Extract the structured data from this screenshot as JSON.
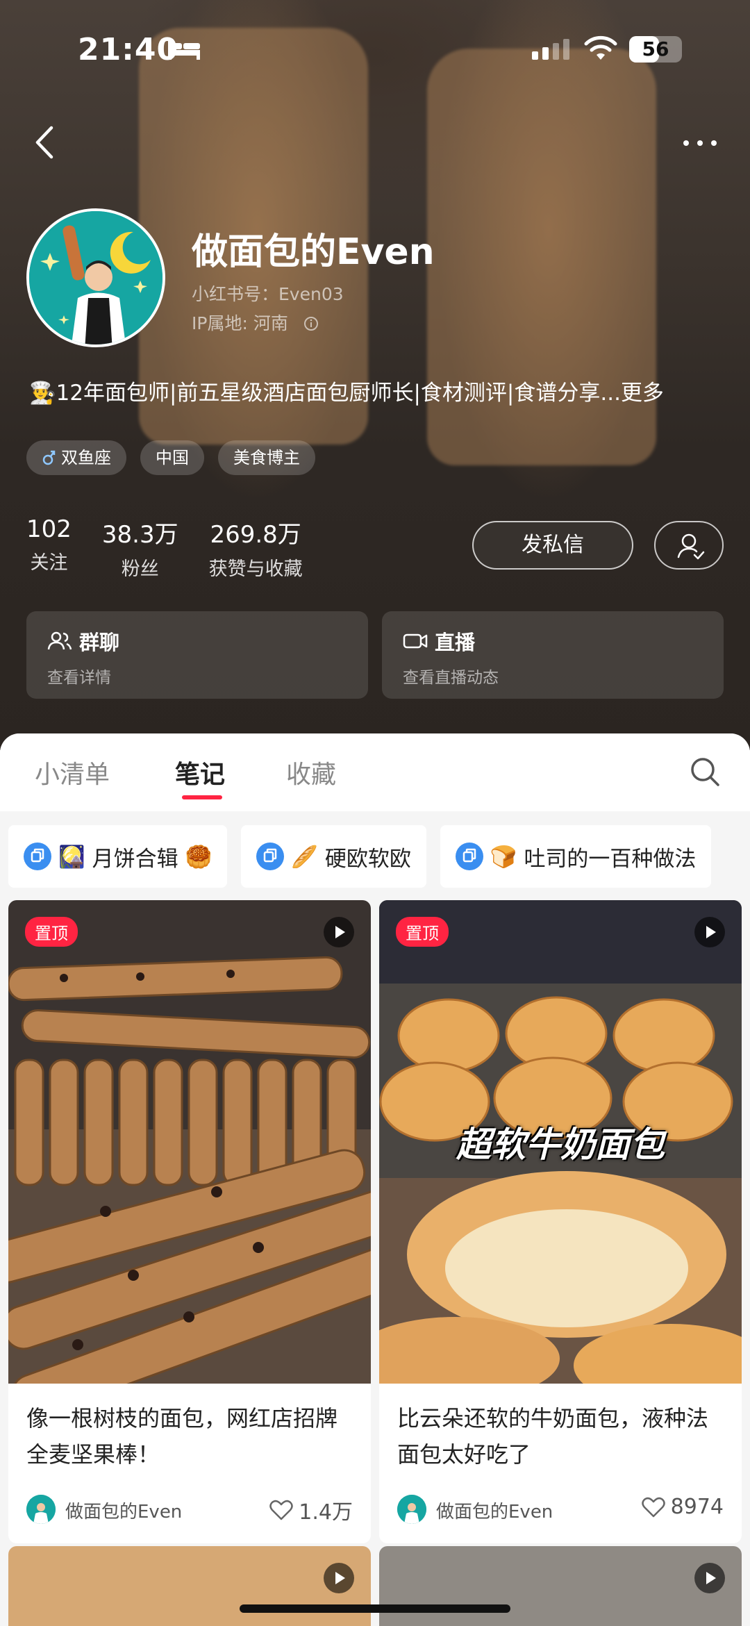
{
  "status_bar": {
    "time": "21:40",
    "battery": "56",
    "battery_level": 0.56
  },
  "profile": {
    "nickname": "做面包的Even",
    "user_id": "小红书号：Even03",
    "ip_location": "IP属地: 河南",
    "bio": "👨‍🍳12年面包师|前五星级酒店面包厨师长|食材测评|食谱分享...",
    "bio_more": "更多",
    "tags": [
      "双鱼座",
      "中国",
      "美食博主"
    ],
    "stats": [
      {
        "value": "102",
        "label": "关注"
      },
      {
        "value": "38.3万",
        "label": "粉丝"
      },
      {
        "value": "269.8万",
        "label": "获赞与收藏"
      }
    ],
    "message_button": "发私信",
    "cards": [
      {
        "title": "群聊",
        "subtitle": "查看详情"
      },
      {
        "title": "直播",
        "subtitle": "查看直播动态"
      }
    ]
  },
  "tabs": [
    "小清单",
    "笔记",
    "收藏"
  ],
  "active_tab": "笔记",
  "collections": [
    {
      "emoji_pre": "🎑",
      "label": "月饼合辑",
      "emoji_post": "🥮"
    },
    {
      "emoji_pre": "🥖",
      "label": "硬欧软欧",
      "emoji_post": ""
    },
    {
      "emoji_pre": "🍞",
      "label": "吐司的一百种做法",
      "emoji_post": ""
    }
  ],
  "notes": [
    {
      "pinned": "置顶",
      "title": "像一根树枝的面包，网红店招牌全麦坚果棒！",
      "author": "做面包的Even",
      "likes": "1.4万"
    },
    {
      "pinned": "置顶",
      "overlay": "超软牛奶面包",
      "title": "比云朵还软的牛奶面包，液种法面包太好吃了",
      "author": "做面包的Even",
      "likes": "8974"
    }
  ],
  "colors": {
    "accent": "#ff2442",
    "avatar_bg": "#16a6a2"
  }
}
